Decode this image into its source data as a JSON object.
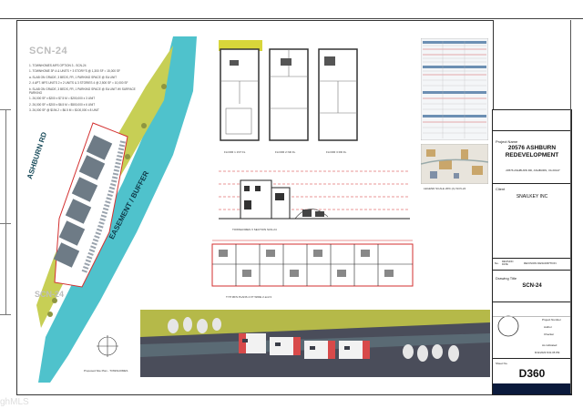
{
  "sheet": {
    "id": "SCN-24",
    "notes": [
      "1. TOWNHOMES-MFS OPTION 3 - SCN-24",
      "1. TOWNHOME 3P-4 & UNITS + 3 STORY'S @ 1,300 SF = 15,000 SF",
      "a. SLAB ON GRADE, 3 BEDS, FR, 1 PARKING SPACE @ EA UNIT",
      "2. 4 APT. MFS UNITS 2 x 2 UNITS & 3 STORIES 4 @ 2,500 SF = 10,000 SF",
      "b. SLAB ON GRADE, 3 BEDS, FR, 1 PARKING SPACE @ EA UNIT W/ SURFACE PARKING",
      "1. 26,000 SF x $200 x $7.5 M = $200,000 x 3 UNIT",
      "2. 26,000 SF x $200 x $6.5 M = $500,000 x 6 UNIT",
      "3. 26,000 SF @ $194.2 = $6.5 M = $100,000 x 8 UNIT"
    ],
    "road_label": "ASHBURN RD",
    "easement_label": "EASEMENT / BUFFER",
    "site_label": "SCN-24",
    "proposed_site_plan": "Proposed Site Plan - TOWNHOMES",
    "floor_plan_labels": [
      "FLOOR 1 1ST FL",
      "FLOOR 2 ND FL",
      "FLOOR 3 RD FL"
    ],
    "section_label": "TOWNHOMES X SECTION SCN-24",
    "plan_label": "TYP MFS PLANS 4 FT WIDE 2 and 3",
    "legend_caption": "LEGEND SCALE 20% (A) SCN-24"
  },
  "title_block": {
    "project_name_label": "Project Name",
    "project_title": "20576 ASHBURN REDEVELOPMENT",
    "project_address": "20576 ASHBURN RD, ASHBURN, VA 20147",
    "client_label": "Client",
    "client": "SNAILKEY INC",
    "revision_header": [
      "No.",
      "REVISION DATE",
      "REVISION DESCRIPTION"
    ],
    "drawing_title_label": "Drawing Title",
    "drawing_title": "SCN-24",
    "project_number_label": "Project Number",
    "author_label": "Author",
    "checker_label": "Checker",
    "scale": "As indicated",
    "date": "8/11/2023 8:01:05 PM",
    "sheet_number_label": "Sheet No.",
    "sheet_number": "D360"
  },
  "watermark": "ghMLS",
  "colors": {
    "water": "#4fc2cc",
    "grass": "#c7cf55",
    "buildings": "#6e7b86",
    "redline": "#d32f2f",
    "title_dark": "#0b1a3c",
    "render_sky": "#b5b949",
    "render_ground": "#4a4d5a"
  }
}
